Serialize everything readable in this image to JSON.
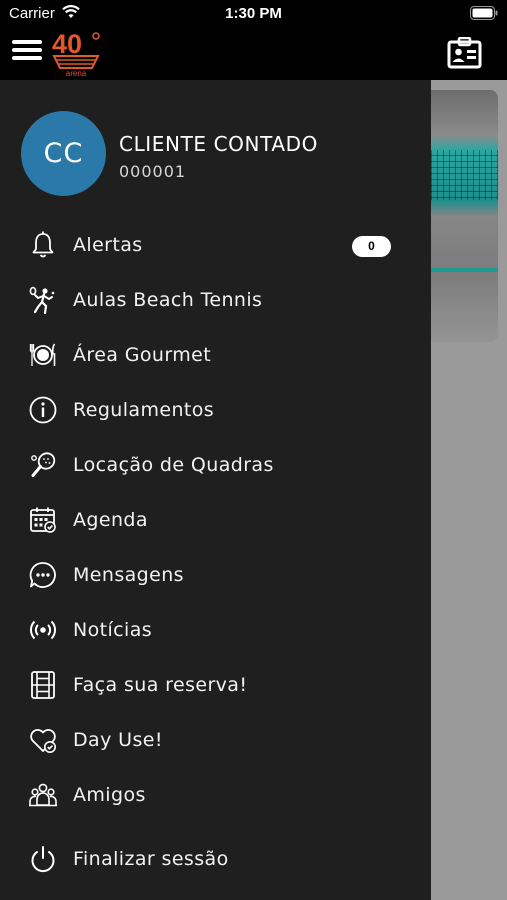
{
  "status_bar": {
    "carrier": "Carrier",
    "time": "1:30 PM"
  },
  "header": {
    "logo_text": "40",
    "logo_subtext": "arena"
  },
  "user": {
    "initials": "CC",
    "name": "CLIENTE CONTADO",
    "id": "000001"
  },
  "menu": {
    "items": [
      {
        "label": "Alertas",
        "badge": "0"
      },
      {
        "label": "Aulas Beach Tennis"
      },
      {
        "label": "Área Gourmet"
      },
      {
        "label": "Regulamentos"
      },
      {
        "label": "Locação de Quadras"
      },
      {
        "label": "Agenda"
      },
      {
        "label": "Mensagens"
      },
      {
        "label": "Notícias"
      },
      {
        "label": "Faça sua reserva!"
      },
      {
        "label": "Day Use!"
      },
      {
        "label": "Amigos"
      }
    ],
    "logout_label": "Finalizar sessão"
  },
  "colors": {
    "avatar": "#2b79a9",
    "logo": "#e0582b",
    "drawer": "#1f1f1f"
  }
}
